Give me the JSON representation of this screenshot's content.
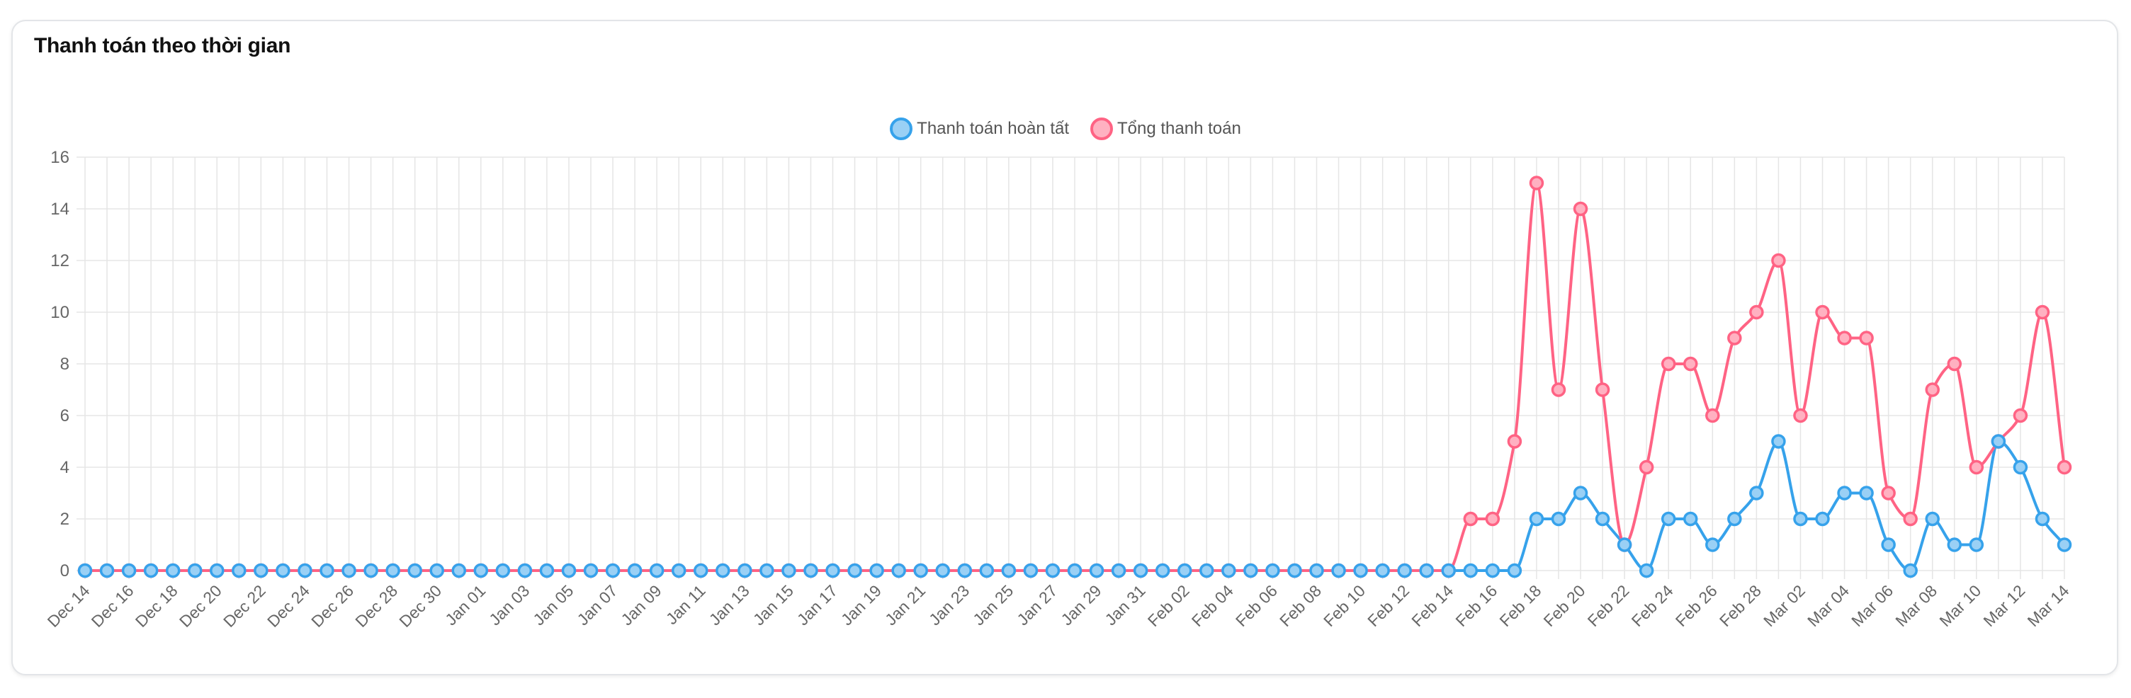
{
  "card": {
    "title": "Thanh toán theo thời gian"
  },
  "chart_data": {
    "type": "line",
    "title": "Thanh toán theo thời gian",
    "xlabel": "",
    "ylabel": "",
    "ylim": [
      0,
      16
    ],
    "yticks": [
      0,
      2,
      4,
      6,
      8,
      10,
      12,
      14,
      16
    ],
    "grid": true,
    "legend_position": "top-center",
    "x_tick_labels": [
      "Dec 14",
      "Dec 16",
      "Dec 18",
      "Dec 20",
      "Dec 22",
      "Dec 24",
      "Dec 26",
      "Dec 28",
      "Dec 30",
      "Jan 01",
      "Jan 03",
      "Jan 05",
      "Jan 07",
      "Jan 09",
      "Jan 11",
      "Jan 13",
      "Jan 15",
      "Jan 17",
      "Jan 19",
      "Jan 21",
      "Jan 23",
      "Jan 25",
      "Jan 27",
      "Jan 29",
      "Jan 31",
      "Feb 02",
      "Feb 04",
      "Feb 06",
      "Feb 08",
      "Feb 10",
      "Feb 12",
      "Feb 14",
      "Feb 16",
      "Feb 18",
      "Feb 20",
      "Feb 22",
      "Feb 24",
      "Feb 26",
      "Feb 28",
      "Mar 02",
      "Mar 04",
      "Mar 06",
      "Mar 08",
      "Mar 10",
      "Mar 12",
      "Mar 14"
    ],
    "x": [
      "Dec 14",
      "Dec 15",
      "Dec 16",
      "Dec 17",
      "Dec 18",
      "Dec 19",
      "Dec 20",
      "Dec 21",
      "Dec 22",
      "Dec 23",
      "Dec 24",
      "Dec 25",
      "Dec 26",
      "Dec 27",
      "Dec 28",
      "Dec 29",
      "Dec 30",
      "Dec 31",
      "Jan 01",
      "Jan 02",
      "Jan 03",
      "Jan 04",
      "Jan 05",
      "Jan 06",
      "Jan 07",
      "Jan 08",
      "Jan 09",
      "Jan 10",
      "Jan 11",
      "Jan 12",
      "Jan 13",
      "Jan 14",
      "Jan 15",
      "Jan 16",
      "Jan 17",
      "Jan 18",
      "Jan 19",
      "Jan 20",
      "Jan 21",
      "Jan 22",
      "Jan 23",
      "Jan 24",
      "Jan 25",
      "Jan 26",
      "Jan 27",
      "Jan 28",
      "Jan 29",
      "Jan 30",
      "Jan 31",
      "Feb 01",
      "Feb 02",
      "Feb 03",
      "Feb 04",
      "Feb 05",
      "Feb 06",
      "Feb 07",
      "Feb 08",
      "Feb 09",
      "Feb 10",
      "Feb 11",
      "Feb 12",
      "Feb 13",
      "Feb 14",
      "Feb 15",
      "Feb 16",
      "Feb 17",
      "Feb 18",
      "Feb 19",
      "Feb 20",
      "Feb 21",
      "Feb 22",
      "Feb 23",
      "Feb 24",
      "Feb 25",
      "Feb 26",
      "Feb 27",
      "Feb 28",
      "Mar 01",
      "Mar 02",
      "Mar 03",
      "Mar 04",
      "Mar 05",
      "Mar 06",
      "Mar 07",
      "Mar 08",
      "Mar 09",
      "Mar 10",
      "Mar 11",
      "Mar 12",
      "Mar 13",
      "Mar 14"
    ],
    "series": [
      {
        "name": "Thanh toán hoàn tất",
        "color": "#36a2eb",
        "fill": "#9ad0f5",
        "values": [
          0,
          0,
          0,
          0,
          0,
          0,
          0,
          0,
          0,
          0,
          0,
          0,
          0,
          0,
          0,
          0,
          0,
          0,
          0,
          0,
          0,
          0,
          0,
          0,
          0,
          0,
          0,
          0,
          0,
          0,
          0,
          0,
          0,
          0,
          0,
          0,
          0,
          0,
          0,
          0,
          0,
          0,
          0,
          0,
          0,
          0,
          0,
          0,
          0,
          0,
          0,
          0,
          0,
          0,
          0,
          0,
          0,
          0,
          0,
          0,
          0,
          0,
          0,
          0,
          0,
          0,
          2,
          2,
          3,
          2,
          1,
          0,
          2,
          2,
          1,
          2,
          3,
          5,
          2,
          2,
          3,
          3,
          1,
          0,
          2,
          1,
          1,
          5,
          4,
          2,
          1
        ]
      },
      {
        "name": "Tổng thanh toán",
        "color": "#ff6384",
        "fill": "#ffb1c1",
        "values": [
          0,
          0,
          0,
          0,
          0,
          0,
          0,
          0,
          0,
          0,
          0,
          0,
          0,
          0,
          0,
          0,
          0,
          0,
          0,
          0,
          0,
          0,
          0,
          0,
          0,
          0,
          0,
          0,
          0,
          0,
          0,
          0,
          0,
          0,
          0,
          0,
          0,
          0,
          0,
          0,
          0,
          0,
          0,
          0,
          0,
          0,
          0,
          0,
          0,
          0,
          0,
          0,
          0,
          0,
          0,
          0,
          0,
          0,
          0,
          0,
          0,
          0,
          0,
          2,
          2,
          5,
          15,
          7,
          14,
          7,
          1,
          4,
          8,
          8,
          6,
          9,
          10,
          12,
          6,
          10,
          9,
          9,
          3,
          2,
          7,
          8,
          4,
          5,
          6,
          10,
          4
        ]
      }
    ]
  },
  "colors": {
    "grid": "#e5e5e5",
    "axis_text": "#666666",
    "title": "#111111"
  }
}
